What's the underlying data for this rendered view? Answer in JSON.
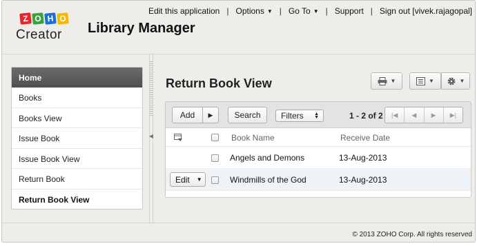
{
  "topnav": {
    "edit_app": "Edit this application",
    "options": "Options",
    "goto": "Go To",
    "support": "Support",
    "signout": "Sign out [vivek.rajagopal]"
  },
  "logo": {
    "letters": [
      "Z",
      "O",
      "H",
      "O"
    ],
    "colors": [
      "#e4262a",
      "#3aa13e",
      "#1f6fd0",
      "#f5b800"
    ],
    "product": "Creator"
  },
  "app": {
    "title": "Library Manager"
  },
  "sidebar": {
    "home": "Home",
    "items": [
      {
        "label": "Books"
      },
      {
        "label": "Books View"
      },
      {
        "label": "Issue Book"
      },
      {
        "label": "Issue Book View"
      },
      {
        "label": "Return Book"
      },
      {
        "label": "Return Book View"
      }
    ]
  },
  "view": {
    "title": "Return Book View",
    "toolbar": {
      "add": "Add",
      "search": "Search",
      "filters": "Filters",
      "pager": "1 - 2 of 2"
    },
    "columns": [
      "Book Name",
      "Receive Date"
    ],
    "rows": [
      {
        "book": "Angels and Demons",
        "date": "13-Aug-2013"
      },
      {
        "book": "Windmills of the God",
        "date": "13-Aug-2013"
      }
    ],
    "edit_label": "Edit"
  },
  "footer": {
    "copyright": "© 2013 ZOHO Corp. All rights reserved"
  }
}
